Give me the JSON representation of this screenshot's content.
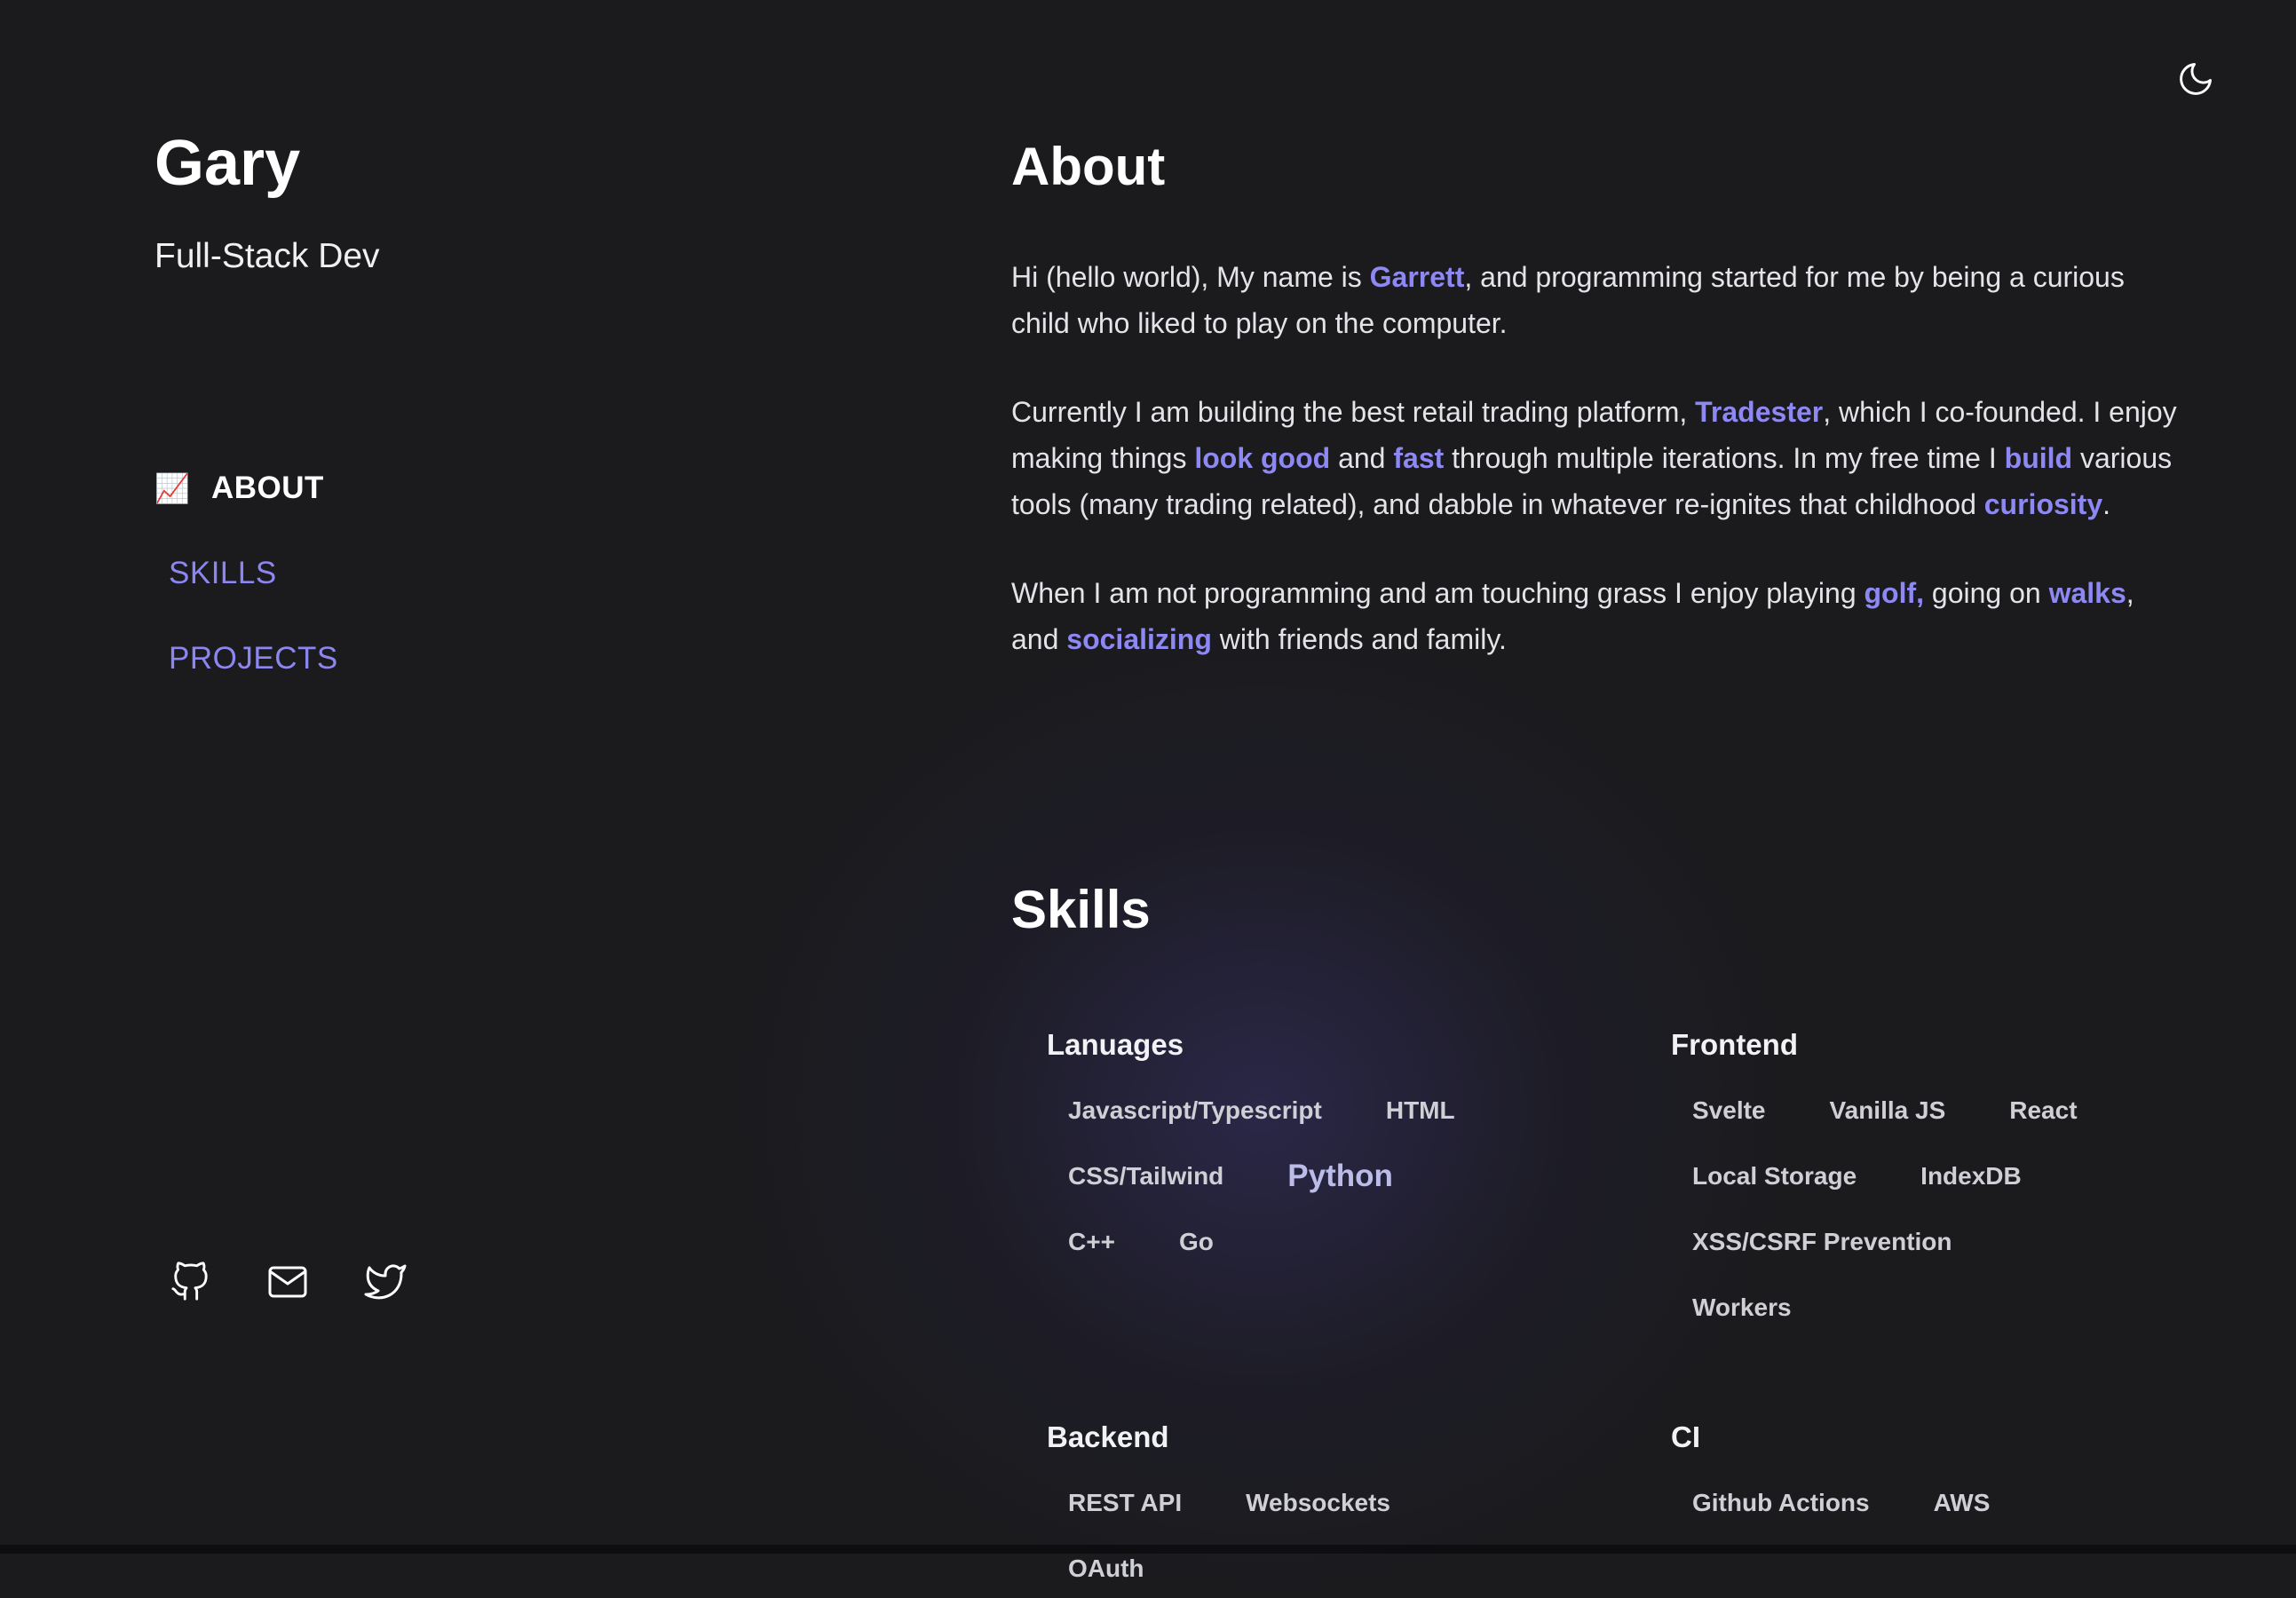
{
  "colors": {
    "background": "#1b1b1e",
    "accent": "#8d88f2",
    "text": "#e5e5e8"
  },
  "theme_toggle": {
    "icon": "moon-icon"
  },
  "sidebar": {
    "name": "Gary",
    "role": "Full-Stack Dev",
    "nav": [
      {
        "label": "ABOUT",
        "icon": "📈",
        "active": true
      },
      {
        "label": "SKILLS",
        "active": false
      },
      {
        "label": "PROJECTS",
        "active": false
      }
    ],
    "socials": [
      {
        "icon": "github-icon"
      },
      {
        "icon": "mail-icon"
      },
      {
        "icon": "twitter-icon"
      }
    ]
  },
  "about": {
    "title": "About",
    "p1": {
      "t1": "Hi (hello world), My name is ",
      "h1": "Garrett",
      "t2": ", and programming started for me by being a curious child who liked to play on the computer."
    },
    "p2": {
      "t1": "Currently I am building the best retail trading platform, ",
      "h1": "Tradester",
      "t2": ", which I co-founded. I enjoy making things ",
      "h2": "look good",
      "t3": " and ",
      "h3": "fast",
      "t4": " through multiple iterations. In my free time I ",
      "h4": "build",
      "t5": " various tools (many trading related), and dabble in whatever re-ignites that childhood ",
      "h5": "curiosity",
      "t6": "."
    },
    "p3": {
      "t1": "When I am not programming and am touching grass I enjoy playing ",
      "h1": "golf,",
      "t2": " going on ",
      "h2": "walks",
      "t3": ", and ",
      "h3": "socializing",
      "t4": " with friends and family."
    }
  },
  "skills": {
    "title": "Skills",
    "groups": [
      {
        "title": "Lanuages",
        "tags": [
          "Javascript/Typescript",
          "HTML",
          "CSS/Tailwind",
          "Python",
          "C++",
          "Go"
        ]
      },
      {
        "title": "Frontend",
        "tags": [
          "Svelte",
          "Vanilla JS",
          "React",
          "Local Storage",
          "IndexDB",
          "XSS/CSRF Prevention",
          "Workers"
        ]
      },
      {
        "title": "Backend",
        "tags": [
          "REST API",
          "Websockets",
          "OAuth"
        ]
      },
      {
        "title": "CI",
        "tags": [
          "Github Actions",
          "AWS"
        ]
      }
    ]
  }
}
